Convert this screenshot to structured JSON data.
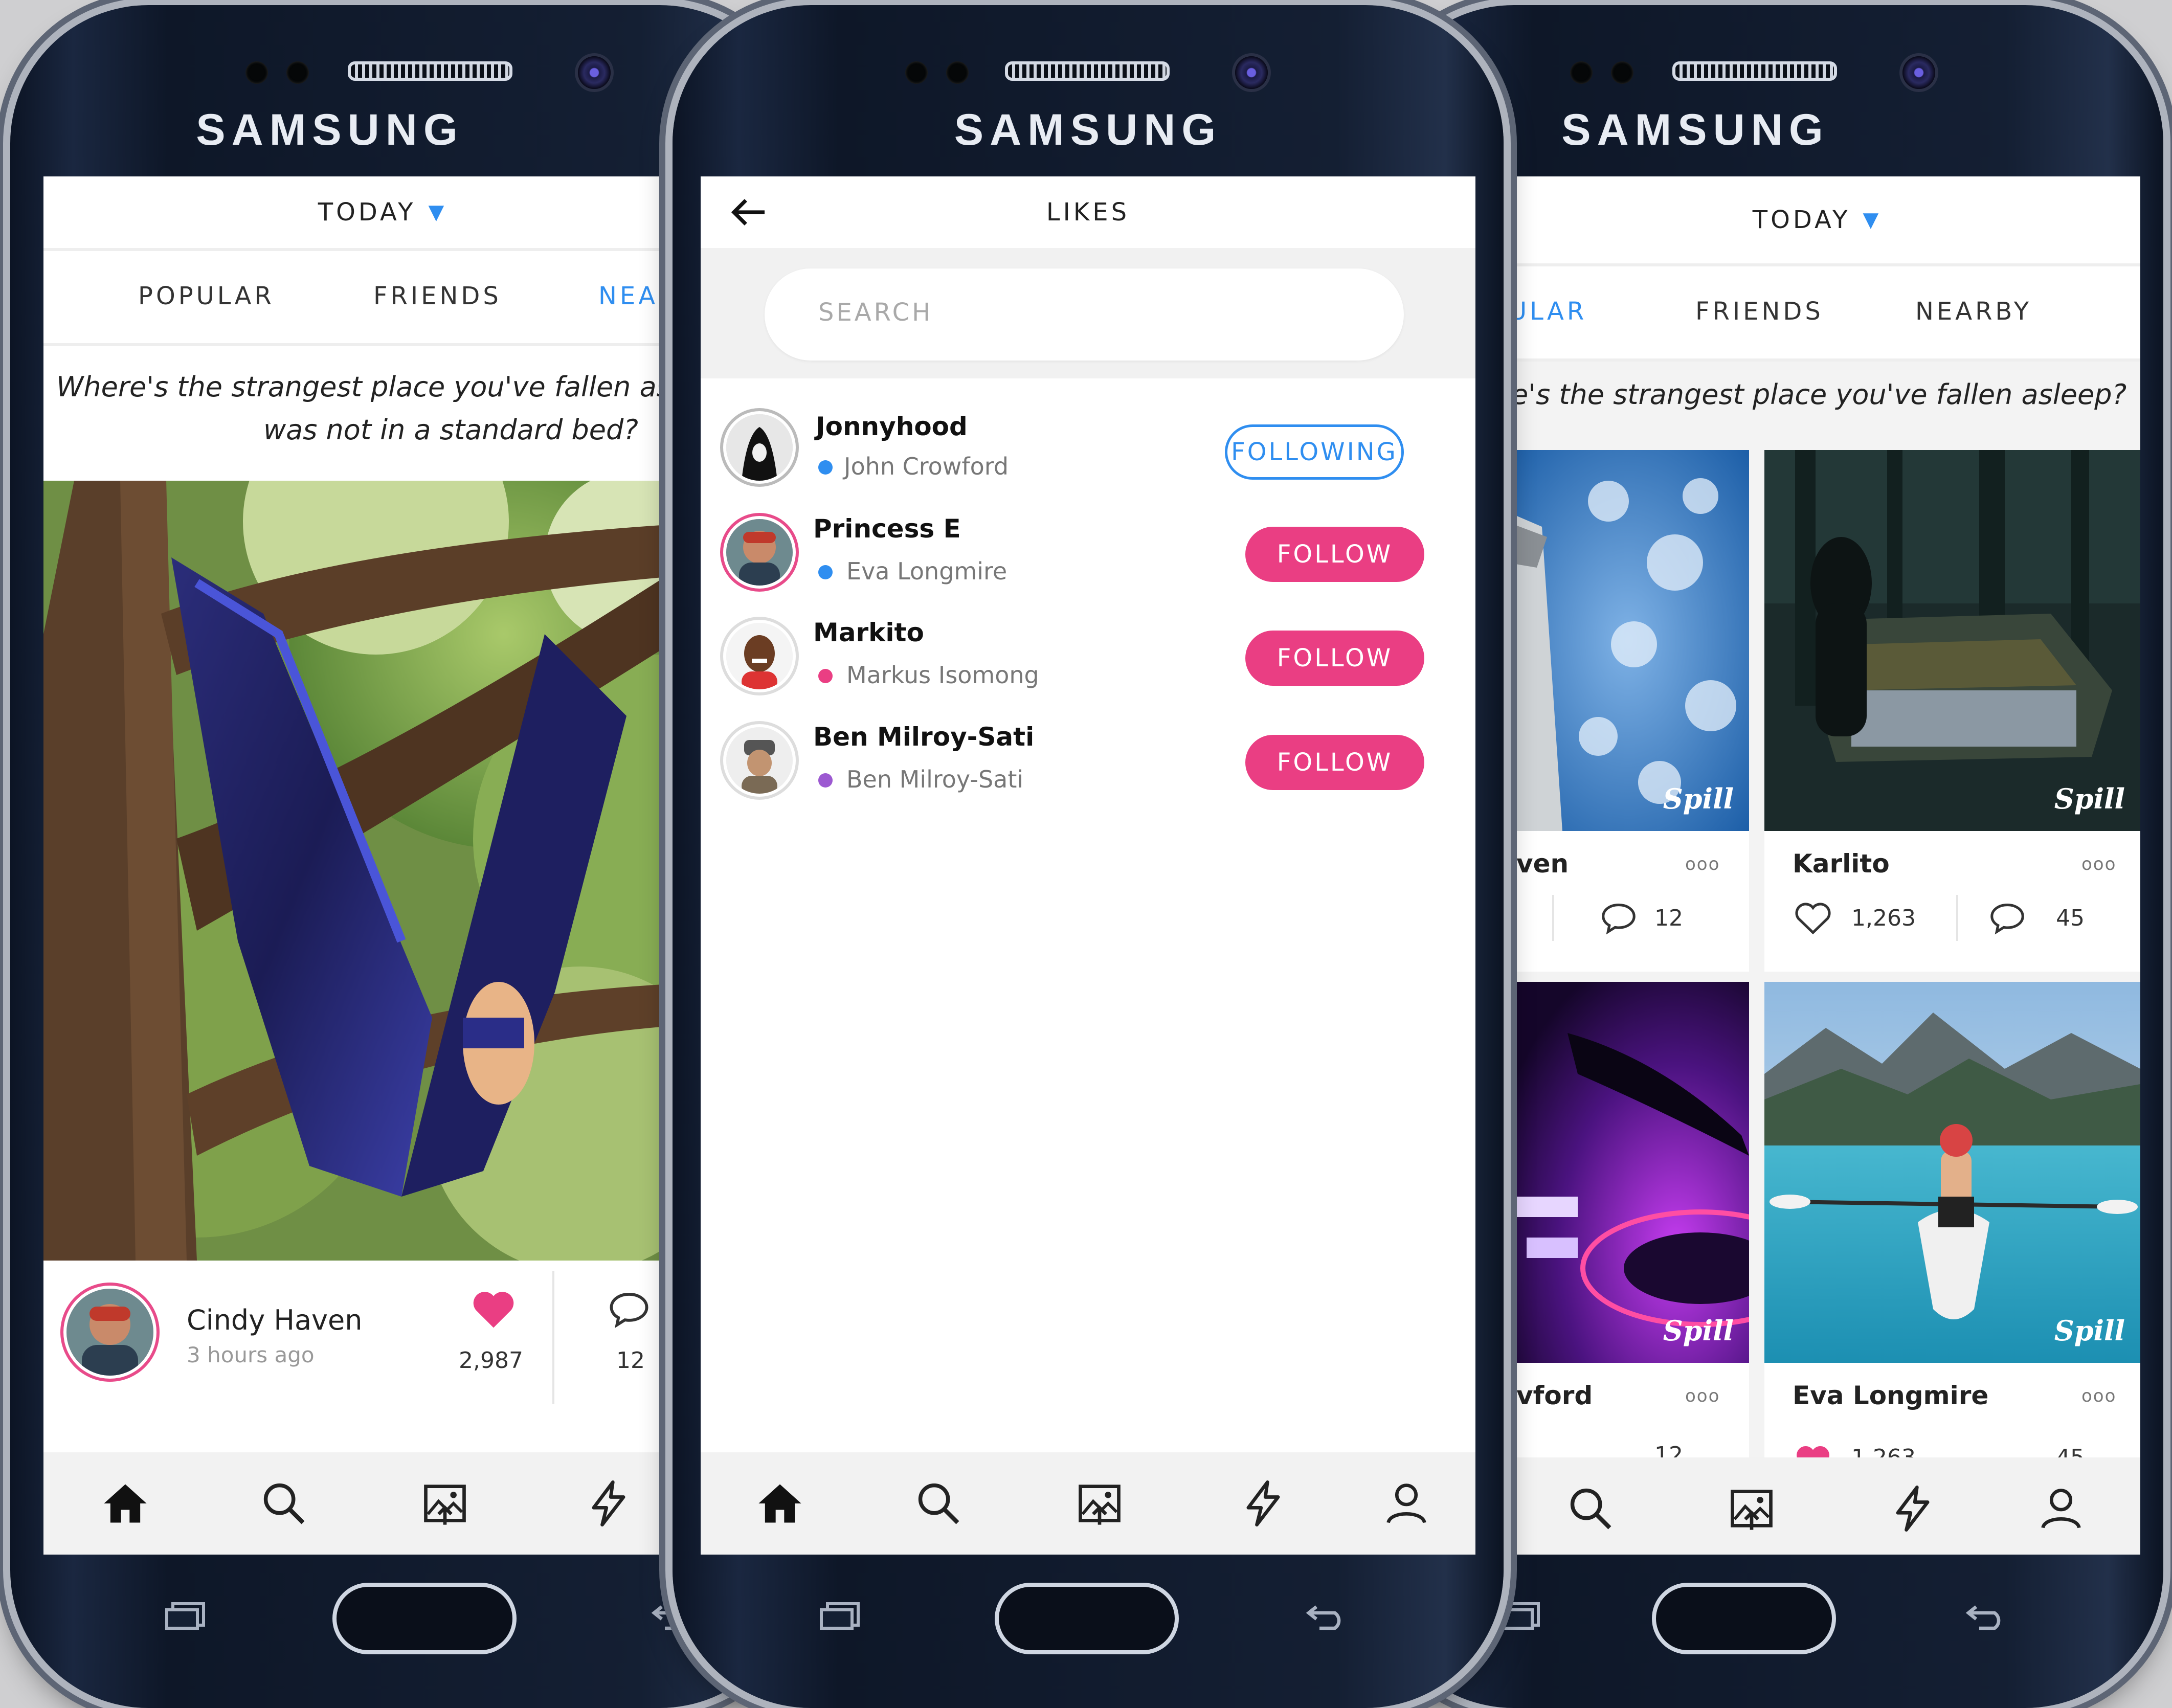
{
  "device_brand": "SAMSUNG",
  "watermark": "Spill",
  "colors": {
    "accent_blue": "#2f8ef0",
    "accent_pink": "#ea3e83"
  },
  "phone_left": {
    "header": {
      "title": "TODAY",
      "dropdown_icon": "triangle-down-icon"
    },
    "tabs": [
      {
        "label": "POPULAR"
      },
      {
        "label": "FRIENDS"
      },
      {
        "label": "NEAR"
      }
    ],
    "question": {
      "line1": "Where's the strangest place you've fallen asle",
      "line2": "was not in a standard bed?"
    },
    "post": {
      "author": "Cindy Haven",
      "time": "3 hours ago",
      "likes": "2,987",
      "comments": "12"
    },
    "nav_icons": [
      "home-icon",
      "search-icon",
      "upload-image-icon",
      "lightning-icon"
    ]
  },
  "phone_center": {
    "header": {
      "title": "LIKES",
      "back_icon": "back-arrow-icon"
    },
    "search": {
      "placeholder": "SEARCH"
    },
    "users": [
      {
        "username": "Jonnyhood",
        "name": "John Crowford",
        "dot_color": "#2f8ef0",
        "button": "FOLLOWING",
        "state": "following"
      },
      {
        "username": "Princess E",
        "name": "Eva Longmire",
        "dot_color": "#2f8ef0",
        "button": "FOLLOW",
        "state": "follow"
      },
      {
        "username": "Markito",
        "name": "Markus Isomong",
        "dot_color": "#ea3e83",
        "button": "FOLLOW",
        "state": "follow"
      },
      {
        "username": "Ben Milroy-Sati",
        "name": "Ben Milroy-Sati",
        "dot_color": "#9c59d1",
        "button": "FOLLOW",
        "state": "follow"
      }
    ],
    "nav_icons": [
      "home-icon",
      "search-icon",
      "upload-image-icon",
      "lightning-icon",
      "profile-icon"
    ]
  },
  "phone_right": {
    "header": {
      "title": "TODAY",
      "dropdown_icon": "triangle-down-icon"
    },
    "tabs": [
      {
        "label": "ULAR"
      },
      {
        "label": "FRIENDS"
      },
      {
        "label": "NEARBY"
      }
    ],
    "question": "e's the strangest place you've fallen asleep?",
    "cards": [
      {
        "name": "ven",
        "likes": "",
        "comments": "12"
      },
      {
        "name": "Karlito",
        "likes": "1,263",
        "comments": "45"
      },
      {
        "name": "vford",
        "likes": "",
        "comments": "12"
      },
      {
        "name": "Eva Longmire",
        "likes": "1,263",
        "comments": "45"
      }
    ],
    "nav_icons": [
      "search-icon",
      "upload-image-icon",
      "lightning-icon",
      "profile-icon"
    ]
  }
}
